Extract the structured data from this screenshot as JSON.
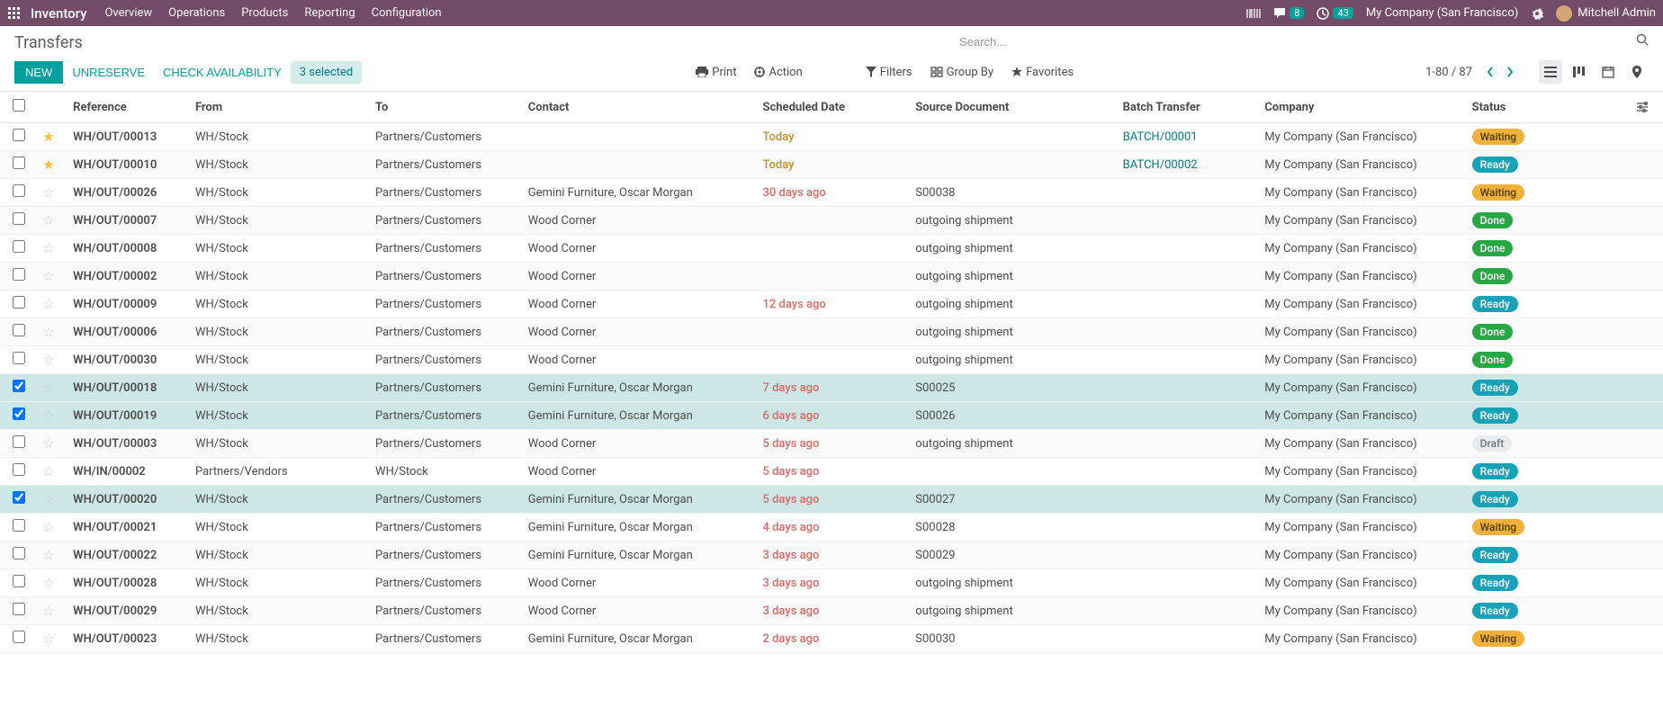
{
  "topbar": {
    "brand": "Inventory",
    "nav": [
      "Overview",
      "Operations",
      "Products",
      "Reporting",
      "Configuration"
    ],
    "messages_count": "8",
    "activities_count": "43",
    "company": "My Company (San Francisco)",
    "user": "Mitchell Admin"
  },
  "breadcrumb": "Transfers",
  "search": {
    "placeholder": "Search..."
  },
  "buttons": {
    "new": "NEW",
    "unreserve": "UNRESERVE",
    "check_availability": "CHECK AVAILABILITY",
    "selected": "3 selected",
    "print": "Print",
    "action": "Action"
  },
  "toolbar": {
    "filters": "Filters",
    "group_by": "Group By",
    "favorites": "Favorites",
    "pager": "1-80 / 87"
  },
  "columns": [
    "Reference",
    "From",
    "To",
    "Contact",
    "Scheduled Date",
    "Source Document",
    "Batch Transfer",
    "Company",
    "Status"
  ],
  "company_name": "My Company (San Francisco)",
  "rows": [
    {
      "sel": false,
      "star": true,
      "ref": "WH/OUT/00013",
      "from": "WH/Stock",
      "to": "Partners/Customers",
      "contact": "",
      "date": "Today",
      "date_class": "date-today",
      "src": "",
      "batch": "BATCH/00001",
      "company": "My Company (San Francisco)",
      "status": "Waiting",
      "status_class": "badge-waiting"
    },
    {
      "sel": false,
      "star": true,
      "ref": "WH/OUT/00010",
      "from": "WH/Stock",
      "to": "Partners/Customers",
      "contact": "",
      "date": "Today",
      "date_class": "date-today",
      "src": "",
      "batch": "BATCH/00002",
      "company": "My Company (San Francisco)",
      "status": "Ready",
      "status_class": "badge-ready"
    },
    {
      "sel": false,
      "star": false,
      "ref": "WH/OUT/00026",
      "from": "WH/Stock",
      "to": "Partners/Customers",
      "contact": "Gemini Furniture, Oscar Morgan",
      "date": "30 days ago",
      "date_class": "date-late",
      "src": "S00038",
      "batch": "",
      "company": "My Company (San Francisco)",
      "status": "Waiting",
      "status_class": "badge-waiting"
    },
    {
      "sel": false,
      "star": false,
      "ref": "WH/OUT/00007",
      "from": "WH/Stock",
      "to": "Partners/Customers",
      "contact": "Wood Corner",
      "date": "",
      "date_class": "",
      "src": "outgoing shipment",
      "batch": "",
      "company": "My Company (San Francisco)",
      "status": "Done",
      "status_class": "badge-done"
    },
    {
      "sel": false,
      "star": false,
      "ref": "WH/OUT/00008",
      "from": "WH/Stock",
      "to": "Partners/Customers",
      "contact": "Wood Corner",
      "date": "",
      "date_class": "",
      "src": "outgoing shipment",
      "batch": "",
      "company": "My Company (San Francisco)",
      "status": "Done",
      "status_class": "badge-done"
    },
    {
      "sel": false,
      "star": false,
      "ref": "WH/OUT/00002",
      "from": "WH/Stock",
      "to": "Partners/Customers",
      "contact": "Wood Corner",
      "date": "",
      "date_class": "",
      "src": "outgoing shipment",
      "batch": "",
      "company": "My Company (San Francisco)",
      "status": "Done",
      "status_class": "badge-done"
    },
    {
      "sel": false,
      "star": false,
      "ref": "WH/OUT/00009",
      "from": "WH/Stock",
      "to": "Partners/Customers",
      "contact": "Wood Corner",
      "date": "12 days ago",
      "date_class": "date-late",
      "src": "outgoing shipment",
      "batch": "",
      "company": "My Company (San Francisco)",
      "status": "Ready",
      "status_class": "badge-ready"
    },
    {
      "sel": false,
      "star": false,
      "ref": "WH/OUT/00006",
      "from": "WH/Stock",
      "to": "Partners/Customers",
      "contact": "Wood Corner",
      "date": "",
      "date_class": "",
      "src": "outgoing shipment",
      "batch": "",
      "company": "My Company (San Francisco)",
      "status": "Done",
      "status_class": "badge-done"
    },
    {
      "sel": false,
      "star": false,
      "ref": "WH/OUT/00030",
      "from": "WH/Stock",
      "to": "Partners/Customers",
      "contact": "Wood Corner",
      "date": "",
      "date_class": "",
      "src": "outgoing shipment",
      "batch": "",
      "company": "My Company (San Francisco)",
      "status": "Done",
      "status_class": "badge-done"
    },
    {
      "sel": true,
      "star": false,
      "ref": "WH/OUT/00018",
      "from": "WH/Stock",
      "to": "Partners/Customers",
      "contact": "Gemini Furniture, Oscar Morgan",
      "date": "7 days ago",
      "date_class": "date-late",
      "src": "S00025",
      "batch": "",
      "company": "My Company (San Francisco)",
      "status": "Ready",
      "status_class": "badge-ready"
    },
    {
      "sel": true,
      "star": false,
      "ref": "WH/OUT/00019",
      "from": "WH/Stock",
      "to": "Partners/Customers",
      "contact": "Gemini Furniture, Oscar Morgan",
      "date": "6 days ago",
      "date_class": "date-late",
      "src": "S00026",
      "batch": "",
      "company": "My Company (San Francisco)",
      "status": "Ready",
      "status_class": "badge-ready"
    },
    {
      "sel": false,
      "star": false,
      "ref": "WH/OUT/00003",
      "from": "WH/Stock",
      "to": "Partners/Customers",
      "contact": "Wood Corner",
      "date": "5 days ago",
      "date_class": "date-late",
      "src": "outgoing shipment",
      "batch": "",
      "company": "My Company (San Francisco)",
      "status": "Draft",
      "status_class": "badge-draft"
    },
    {
      "sel": false,
      "star": false,
      "ref": "WH/IN/00002",
      "from": "Partners/Vendors",
      "to": "WH/Stock",
      "contact": "Wood Corner",
      "date": "5 days ago",
      "date_class": "date-late",
      "src": "",
      "batch": "",
      "company": "My Company (San Francisco)",
      "status": "Ready",
      "status_class": "badge-ready"
    },
    {
      "sel": true,
      "star": false,
      "ref": "WH/OUT/00020",
      "from": "WH/Stock",
      "to": "Partners/Customers",
      "contact": "Gemini Furniture, Oscar Morgan",
      "date": "5 days ago",
      "date_class": "date-late",
      "src": "S00027",
      "batch": "",
      "company": "My Company (San Francisco)",
      "status": "Ready",
      "status_class": "badge-ready"
    },
    {
      "sel": false,
      "star": false,
      "ref": "WH/OUT/00021",
      "from": "WH/Stock",
      "to": "Partners/Customers",
      "contact": "Gemini Furniture, Oscar Morgan",
      "date": "4 days ago",
      "date_class": "date-late",
      "src": "S00028",
      "batch": "",
      "company": "My Company (San Francisco)",
      "status": "Waiting",
      "status_class": "badge-waiting"
    },
    {
      "sel": false,
      "star": false,
      "ref": "WH/OUT/00022",
      "from": "WH/Stock",
      "to": "Partners/Customers",
      "contact": "Gemini Furniture, Oscar Morgan",
      "date": "3 days ago",
      "date_class": "date-late",
      "src": "S00029",
      "batch": "",
      "company": "My Company (San Francisco)",
      "status": "Ready",
      "status_class": "badge-ready"
    },
    {
      "sel": false,
      "star": false,
      "ref": "WH/OUT/00028",
      "from": "WH/Stock",
      "to": "Partners/Customers",
      "contact": "Wood Corner",
      "date": "3 days ago",
      "date_class": "date-late",
      "src": "outgoing shipment",
      "batch": "",
      "company": "My Company (San Francisco)",
      "status": "Ready",
      "status_class": "badge-ready"
    },
    {
      "sel": false,
      "star": false,
      "ref": "WH/OUT/00029",
      "from": "WH/Stock",
      "to": "Partners/Customers",
      "contact": "Wood Corner",
      "date": "3 days ago",
      "date_class": "date-late",
      "src": "outgoing shipment",
      "batch": "",
      "company": "My Company (San Francisco)",
      "status": "Ready",
      "status_class": "badge-ready"
    },
    {
      "sel": false,
      "star": false,
      "ref": "WH/OUT/00023",
      "from": "WH/Stock",
      "to": "Partners/Customers",
      "contact": "Gemini Furniture, Oscar Morgan",
      "date": "2 days ago",
      "date_class": "date-late",
      "src": "S00030",
      "batch": "",
      "company": "My Company (San Francisco)",
      "status": "Waiting",
      "status_class": "badge-waiting"
    }
  ]
}
